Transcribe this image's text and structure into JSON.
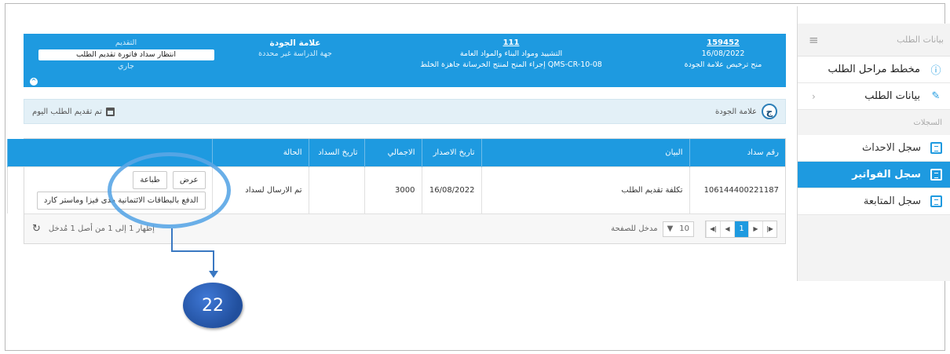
{
  "sidebar": {
    "header_label": "بيانات الطلب",
    "items": [
      {
        "label": "مخطط مراحل الطلب",
        "icon": "info-icon"
      },
      {
        "label": "بيانات الطلب",
        "icon": "edit-icon"
      }
    ],
    "section_label": "السجلات",
    "logs": [
      {
        "label": "سجل الاحداث",
        "active": false
      },
      {
        "label": "سجل الفواتير",
        "active": true
      },
      {
        "label": "سجل المتابعة",
        "active": false
      }
    ]
  },
  "banner": {
    "request_number": "159452",
    "request_date": "16/08/2022",
    "request_type": "منح ترخيص علامة الجودة",
    "product_code": "111",
    "sector": "التشييد ومواد البناء والمواد العامة",
    "procedure": "QMS-CR-10-08 إجراء المنح لمنتج الخرسانة جاهزة الخلط",
    "mark_title": "علامة الجودة",
    "study_body": "جهة الدراسة غير محددة",
    "submission_title": "التقديم",
    "submission_status": "انتظار سداد فاتورة تقديم الطلب",
    "progress_status": "جاري"
  },
  "strip": {
    "mark_label": "علامة الجودة",
    "mark_badge": "ج",
    "submitted_note": "تم تقديم الطلب اليوم"
  },
  "table": {
    "headers": [
      "رقم سداد",
      "البيان",
      "تاريخ الاصدار",
      "الاجمالي",
      "تاريخ السداد",
      "الحالة",
      ""
    ],
    "rows": [
      {
        "payment_no": "106144400221187",
        "description": "تكلفة تقديم الطلب",
        "issue_date": "16/08/2022",
        "total": "3000",
        "payment_date": "",
        "status": "تم الارسال لسداد",
        "actions": {
          "view": "عرض",
          "print": "طباعة",
          "pay": "الدفع بالبطاقات الائتمانية مدى فيزا وماستر كارد"
        }
      }
    ]
  },
  "pager": {
    "current_page": "1",
    "page_size": "10",
    "page_size_label": "مدخل للصفحة",
    "info": "إظهار 1 إلى 1 من أصل 1 مُدخل"
  },
  "annotation": {
    "badge_number": "22"
  }
}
